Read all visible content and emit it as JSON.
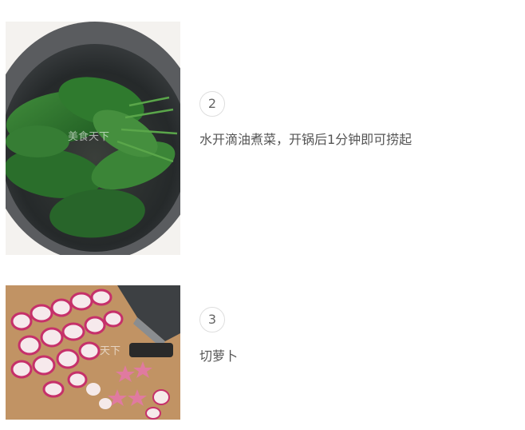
{
  "steps": [
    {
      "number": "2",
      "text": "水开滴油煮菜，开锅后1分钟即可捞起",
      "image_watermark": "美食天下"
    },
    {
      "number": "3",
      "text": "切萝卜",
      "image_watermark": "天下"
    }
  ]
}
